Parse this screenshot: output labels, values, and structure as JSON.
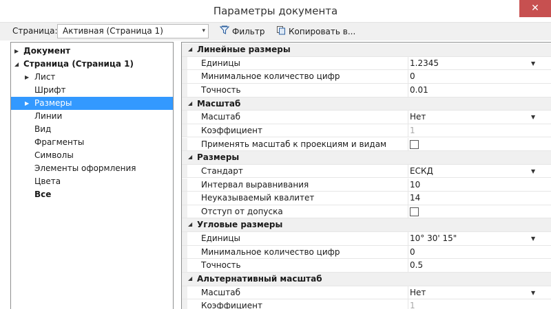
{
  "window": {
    "title": "Параметры документа",
    "close_glyph": "✕"
  },
  "toolbar": {
    "page_label": "Страница:",
    "page_value": "Активная (Страница 1)",
    "filter_label": "Фильтр",
    "copy_label": "Копировать в..."
  },
  "tree": [
    {
      "label": "Документ",
      "bold": true,
      "level": 0,
      "arrow": "▶",
      "selected": false
    },
    {
      "label": "Страница (Страница 1)",
      "bold": true,
      "level": 0,
      "arrow": "◢",
      "selected": false
    },
    {
      "label": "Лист",
      "bold": false,
      "level": 1,
      "arrow": "▶",
      "selected": false
    },
    {
      "label": "Шрифт",
      "bold": false,
      "level": 1,
      "arrow": "",
      "selected": false
    },
    {
      "label": "Размеры",
      "bold": false,
      "level": 1,
      "arrow": "▶",
      "selected": true
    },
    {
      "label": "Линии",
      "bold": false,
      "level": 1,
      "arrow": "",
      "selected": false
    },
    {
      "label": "Вид",
      "bold": false,
      "level": 1,
      "arrow": "",
      "selected": false
    },
    {
      "label": "Фрагменты",
      "bold": false,
      "level": 1,
      "arrow": "",
      "selected": false
    },
    {
      "label": "Символы",
      "bold": false,
      "level": 1,
      "arrow": "",
      "selected": false
    },
    {
      "label": "Элементы оформления",
      "bold": false,
      "level": 1,
      "arrow": "",
      "selected": false
    },
    {
      "label": "Цвета",
      "bold": false,
      "level": 1,
      "arrow": "",
      "selected": false
    },
    {
      "label": "Все",
      "bold": true,
      "level": 1,
      "arrow": "",
      "selected": false
    }
  ],
  "properties": [
    {
      "type": "section",
      "label": "Линейные размеры"
    },
    {
      "type": "row",
      "name": "Единицы",
      "value": "1.2345",
      "dropdown": true
    },
    {
      "type": "row",
      "name": "Минимальное количество цифр",
      "value": "0"
    },
    {
      "type": "row",
      "name": "Точность",
      "value": "0.01"
    },
    {
      "type": "section",
      "label": "Масштаб"
    },
    {
      "type": "row",
      "name": "Масштаб",
      "value": "Нет",
      "dropdown": true
    },
    {
      "type": "row",
      "name": "Коэффициент",
      "value": "1",
      "dim": true
    },
    {
      "type": "row",
      "name": "Применять масштаб к проекциям и видам",
      "checkbox": true
    },
    {
      "type": "section",
      "label": "Размеры"
    },
    {
      "type": "row",
      "name": "Стандарт",
      "value": "ЕСКД",
      "dropdown": true
    },
    {
      "type": "row",
      "name": "Интервал выравнивания",
      "value": "10"
    },
    {
      "type": "row",
      "name": "Неуказываемый квалитет",
      "value": "14"
    },
    {
      "type": "row",
      "name": "Отступ от допуска",
      "checkbox": true
    },
    {
      "type": "section",
      "label": "Угловые размеры"
    },
    {
      "type": "row",
      "name": "Единицы",
      "value": "10° 30' 15\"",
      "dropdown": true
    },
    {
      "type": "row",
      "name": "Минимальное количество цифр",
      "value": "0"
    },
    {
      "type": "row",
      "name": "Точность",
      "value": "0.5"
    },
    {
      "type": "section",
      "label": "Альтернативный масштаб"
    },
    {
      "type": "row",
      "name": "Масштаб",
      "value": "Нет",
      "dropdown": true
    },
    {
      "type": "row",
      "name": "Коэффициент",
      "value": "1",
      "dim": true
    }
  ],
  "icons": {
    "filter": "filter-icon",
    "copy": "copy-icon",
    "close": "close-icon",
    "dropdown": "chevron-down-icon"
  }
}
